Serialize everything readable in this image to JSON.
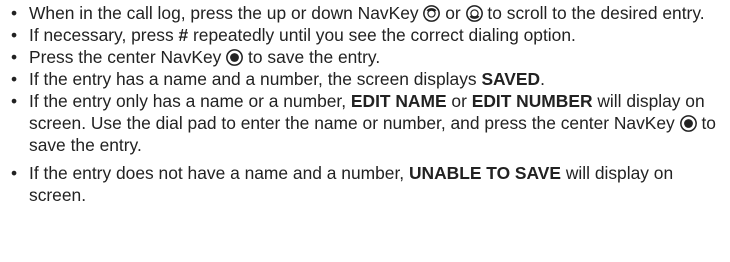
{
  "instructions": {
    "steps": [
      {
        "parts": [
          "When in the call log, press the up or down NavKey",
          "or",
          "to scroll to the desired entry."
        ]
      },
      {
        "parts": [
          "If necessary, press",
          "#",
          "repeatedly until you see the correct dialing option."
        ]
      },
      {
        "parts": [
          "Press the center NavKey",
          "to save the entry."
        ]
      },
      {
        "parts": [
          "If the entry has a name and a number, the screen displays",
          "SAVED",
          "."
        ]
      },
      {
        "parts": [
          "If the entry only has a name or a number,",
          "EDIT NAME",
          "or",
          "EDIT NUMBER",
          "will display on screen. Use the dial pad to enter the name or number, and press the center NavKey",
          "to save the entry."
        ]
      },
      {
        "parts": [
          "If the entry does not have a name and a number,",
          "UNABLE TO SAVE",
          "will display on screen."
        ]
      }
    ]
  }
}
